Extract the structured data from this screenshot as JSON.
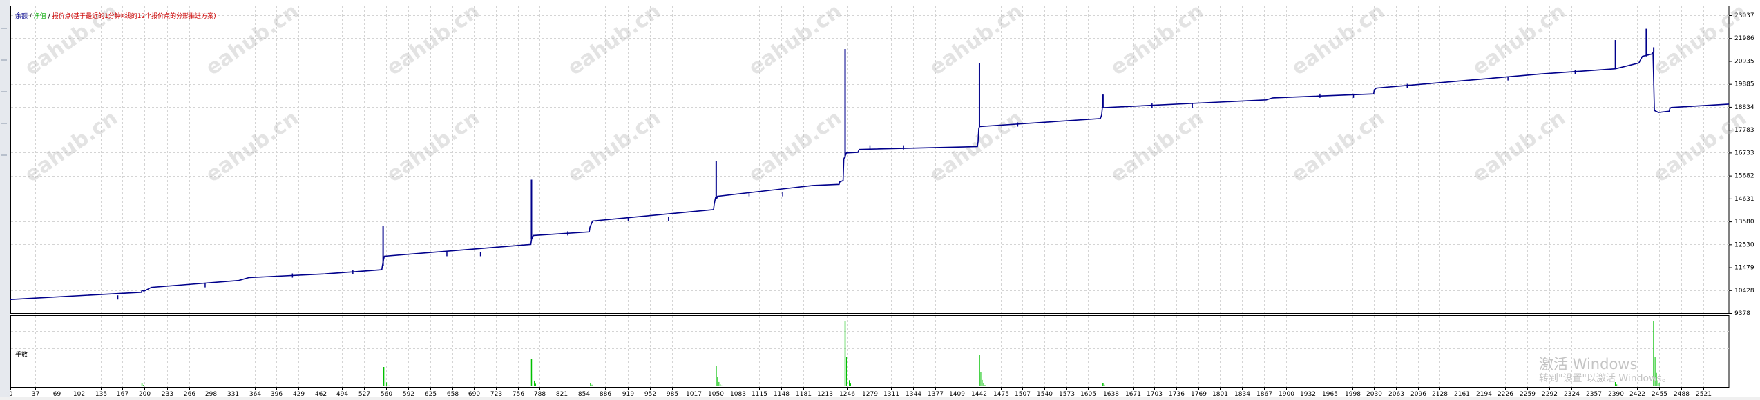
{
  "legend": {
    "balance": "余额",
    "sep1": " / ",
    "equity": "净值",
    "sep2": " / ",
    "desc": "报价点(基于最近的1分钟K线的12个报价点的分形推进方案)"
  },
  "sub_legend": "手数",
  "watermark_text": "eahub.cn",
  "os_watermark": {
    "title": "激活 Windows",
    "subtitle": "转到\"设置\"以激活 Windows。"
  },
  "colors": {
    "balance": "#00008b",
    "equity": "#00aa00",
    "lots": "#00c000",
    "desc": "#cc0000",
    "grid": "#d4d4d4",
    "axis": "#000000"
  },
  "chart_data": [
    {
      "type": "line",
      "title": "",
      "series": [
        {
          "name": "余额"
        },
        {
          "name": "净值"
        }
      ],
      "ylim": [
        9378,
        24080
      ],
      "y_ticks": [
        "23037",
        "21986",
        "20935",
        "19885",
        "18834",
        "17783",
        "16733",
        "15682",
        "14631",
        "13580",
        "12530",
        "11479",
        "10428",
        "9378"
      ],
      "x_ticks": [
        "0",
        "37",
        "69",
        "102",
        "135",
        "167",
        "200",
        "233",
        "266",
        "298",
        "331",
        "364",
        "396",
        "429",
        "462",
        "494",
        "527",
        "560",
        "592",
        "625",
        "658",
        "690",
        "723",
        "756",
        "788",
        "821",
        "854",
        "886",
        "919",
        "952",
        "985",
        "1017",
        "1050",
        "1083",
        "1115",
        "1148",
        "1181",
        "1213",
        "1246",
        "1279",
        "1311",
        "1344",
        "1377",
        "1409",
        "1442",
        "1475",
        "1507",
        "1540",
        "1573",
        "1605",
        "1638",
        "1671",
        "1703",
        "1736",
        "1769",
        "1801",
        "1834",
        "1867",
        "1900",
        "1932",
        "1965",
        "1998",
        "2030",
        "2063",
        "2096",
        "2128",
        "2161",
        "2194",
        "2226",
        "2259",
        "2292",
        "2324",
        "2357",
        "2390",
        "2422",
        "2455",
        "2488",
        "2521"
      ],
      "xlim": [
        0,
        2559
      ],
      "points": [
        [
          0,
          10003
        ],
        [
          195,
          10334
        ],
        [
          196,
          10420
        ],
        [
          199,
          10388
        ],
        [
          210,
          10560
        ],
        [
          340,
          10875
        ],
        [
          355,
          11005
        ],
        [
          468,
          11173
        ],
        [
          553,
          11368
        ],
        [
          554,
          11558
        ],
        [
          556,
          11878
        ],
        [
          557,
          11988
        ],
        [
          775,
          12528
        ],
        [
          776,
          12758
        ],
        [
          778,
          12898
        ],
        [
          779,
          12938
        ],
        [
          862,
          13098
        ],
        [
          863,
          13318
        ],
        [
          867,
          13598
        ],
        [
          1047,
          14125
        ],
        [
          1048,
          14365
        ],
        [
          1049,
          14525
        ],
        [
          1050,
          14673
        ],
        [
          1052,
          14650
        ],
        [
          1053,
          14734
        ],
        [
          1195,
          15232
        ],
        [
          1234,
          15280
        ],
        [
          1235,
          15393
        ],
        [
          1240,
          15454
        ],
        [
          1241,
          16442
        ],
        [
          1242,
          16507
        ],
        [
          1244,
          16637
        ],
        [
          1245,
          16720
        ],
        [
          1262,
          16745
        ],
        [
          1264,
          16883
        ],
        [
          1440,
          17013
        ],
        [
          1441,
          17228
        ],
        [
          1442,
          17838
        ],
        [
          1443,
          17930
        ],
        [
          1623,
          18298
        ],
        [
          1625,
          18458
        ],
        [
          1626,
          18798
        ],
        [
          1870,
          19155
        ],
        [
          1880,
          19247
        ],
        [
          2030,
          19425
        ],
        [
          2031,
          19618
        ],
        [
          2034,
          19698
        ],
        [
          2168,
          20045
        ],
        [
          2280,
          20343
        ],
        [
          2390,
          20580
        ],
        [
          2425,
          20847
        ],
        [
          2430,
          21148
        ],
        [
          2444,
          21253
        ],
        [
          2446,
          21318
        ],
        [
          2448,
          18668
        ],
        [
          2454,
          18580
        ],
        [
          2470,
          18634
        ],
        [
          2471,
          18756
        ],
        [
          2473,
          18808
        ],
        [
          2559,
          18962
        ]
      ],
      "spikes": [
        [
          555,
          13378
        ],
        [
          776,
          15498
        ],
        [
          1051,
          16352
        ],
        [
          1243,
          21488
        ],
        [
          1443,
          20828
        ],
        [
          1627,
          19398
        ],
        [
          2390,
          21898
        ],
        [
          2436,
          22418
        ],
        [
          2447,
          21568
        ]
      ]
    },
    {
      "type": "bar",
      "title": "",
      "label": "手数",
      "x_positions": [
        196,
        556,
        776,
        864,
        1051,
        1243,
        1443,
        1627,
        2390,
        2447
      ],
      "heights": [
        0.04,
        0.28,
        0.4,
        0.05,
        0.3,
        0.95,
        0.45,
        0.05,
        0.06,
        0.95
      ]
    }
  ]
}
